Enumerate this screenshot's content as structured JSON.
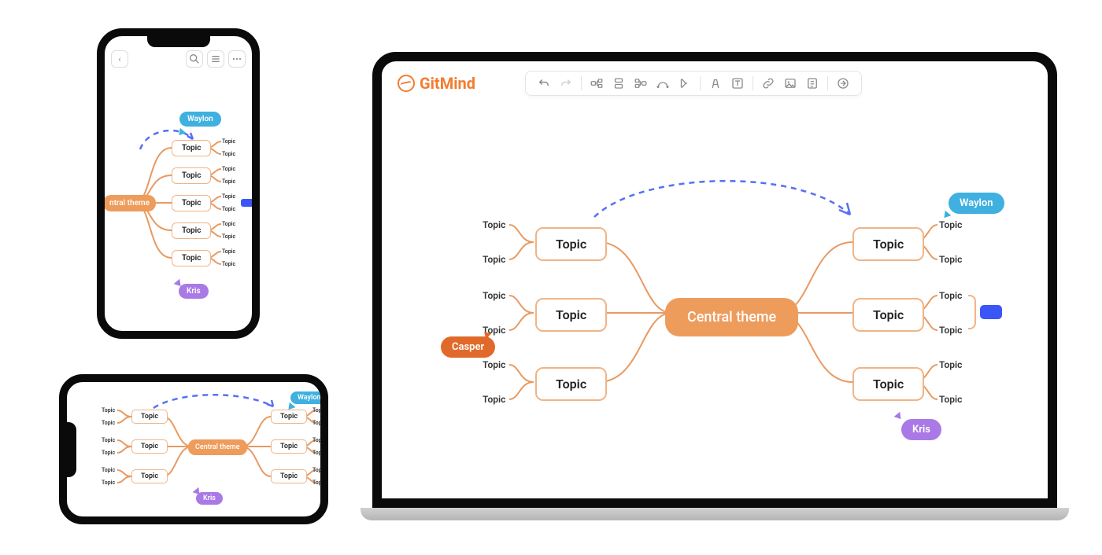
{
  "brand": {
    "name": "GitMind"
  },
  "mindmap": {
    "central": "Central  theme",
    "topic_label": "Topic",
    "sub_label": "Topic"
  },
  "cursors": {
    "waylon": "Waylon",
    "kris": "Kris",
    "casper": "Casper"
  },
  "phone_portrait": {
    "central": "ntral  theme"
  },
  "colors": {
    "accent": "#ee9c5c",
    "brand": "#f27c2f",
    "waylon": "#3fb0e0",
    "kris": "#a97ae6",
    "casper": "#e16a2b",
    "chip": "#3c56f6"
  }
}
